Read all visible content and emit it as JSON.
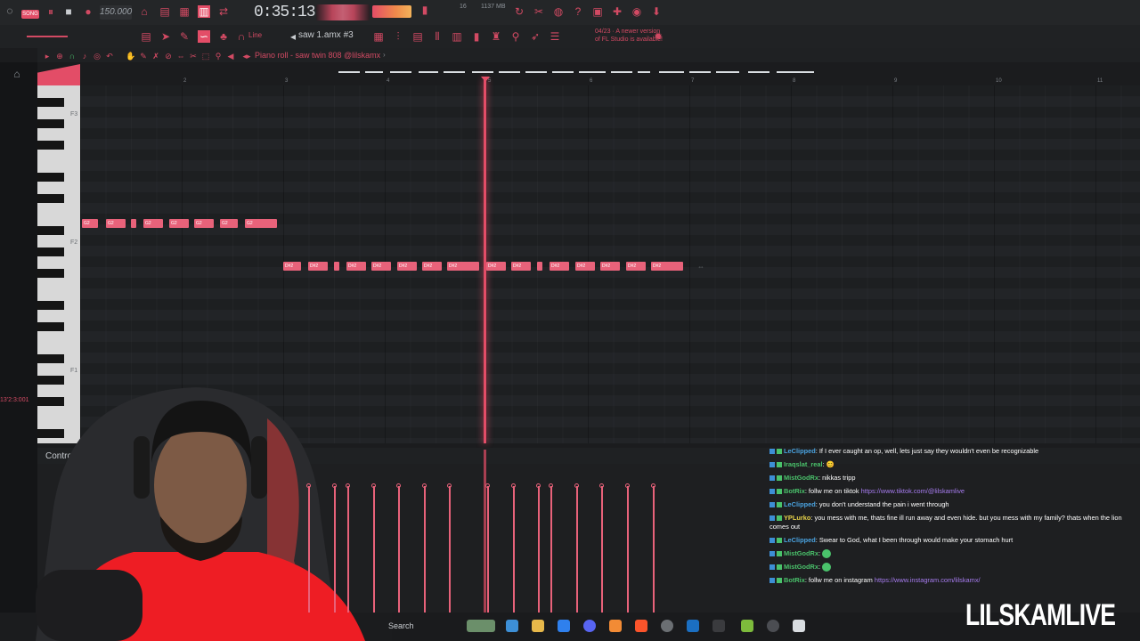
{
  "toolbar": {
    "song_label": "SONG",
    "tempo": "150.000",
    "time": "0:35:13",
    "cpu_text": "1137 MB",
    "cpu_sub": "16",
    "pattern": "saw 1.amx #3",
    "line_mode": "Line",
    "news": "04/23 · A newer version of FL Studio is available!"
  },
  "piano_roll": {
    "title": "Piano roll - saw twin 808 @lilskamx",
    "ruler": [
      "2",
      "3",
      "4",
      "5",
      "6",
      "7",
      "8",
      "9",
      "10",
      "11"
    ],
    "key_labels": [
      "F3",
      "F2",
      "F1"
    ],
    "note_label_a": "G2",
    "note_label_b": "D#2",
    "left_readout": "13'2:3:001"
  },
  "control": {
    "label": "Control"
  },
  "chat": [
    {
      "user": "LeClipped",
      "cls": "user-blue",
      "msg": ": If I ever caught an op, well, lets just say they wouldn't even be recognizable",
      "link": ""
    },
    {
      "user": "Iraqslat_real",
      "cls": "user-green",
      "msg": ": 😊",
      "link": ""
    },
    {
      "user": "MistGodRx",
      "cls": "user-green",
      "msg": ": nikkas tripp",
      "link": ""
    },
    {
      "user": "BotRix",
      "cls": "user-green",
      "msg": ": follw me on tiktok ",
      "link": "https://www.tiktok.com/@lilskamlive"
    },
    {
      "user": "LeClipped",
      "cls": "user-blue",
      "msg": ": you don't understand the pain i went through",
      "link": ""
    },
    {
      "user": "YPLurko",
      "cls": "user-yellow",
      "msg": ": you mess with me, thats fine ill run away and even hide. but you mess with my family? thats when the lion comes out",
      "link": ""
    },
    {
      "user": "LeClipped",
      "cls": "user-blue",
      "msg": ": Swear to God, what I been through would make your stomach hurt",
      "link": ""
    },
    {
      "user": "MistGodRx",
      "cls": "user-green",
      "msg": ": ",
      "link": ""
    },
    {
      "user": "MistGodRx",
      "cls": "user-green",
      "msg": ": ",
      "link": ""
    },
    {
      "user": "BotRix",
      "cls": "user-green",
      "msg": ": follw me on instagram ",
      "link": "https://www.instagram.com/lilskamx/"
    }
  ],
  "taskbar": {
    "search_label": "Search"
  },
  "brand": "LILSKAMLIVE",
  "colors": {
    "accent": "#e34d67",
    "note": "#e8627a",
    "bg": "#1b1c1e"
  }
}
